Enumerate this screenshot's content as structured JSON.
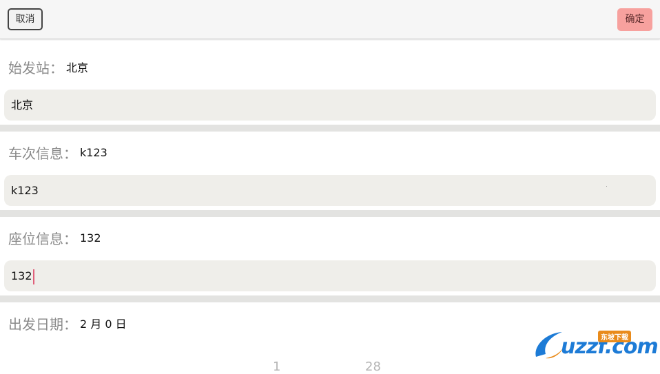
{
  "toolbar": {
    "cancel_label": "取消",
    "confirm_label": "确定"
  },
  "form": {
    "departure": {
      "label": "始发站：",
      "value": "北京",
      "input_value": "北京"
    },
    "train": {
      "label": "车次信息：",
      "value": "k123",
      "input_value": "k123"
    },
    "seat": {
      "label": "座位信息：",
      "value": "132",
      "input_value": "132"
    },
    "date": {
      "label": "出发日期：",
      "value": "2 月 0 日"
    }
  },
  "picker": {
    "left_value": "1",
    "right_value": "28"
  },
  "watermark": {
    "text": "uzzf.com",
    "badge": "东坡下载"
  },
  "colors": {
    "confirm_bg": "#f7a19e",
    "field_bg": "#efeeea",
    "divider": "#e3e3e1",
    "cursor": "#e0607a"
  }
}
